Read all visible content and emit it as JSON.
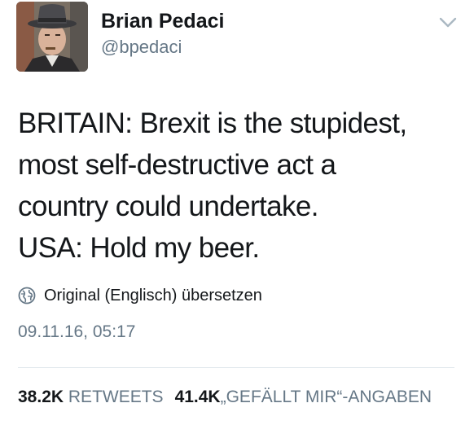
{
  "author": {
    "name": "Brian Pedaci",
    "handle": "@bpedaci"
  },
  "tweet": {
    "lines": [
      "BRITAIN:  Brexit is the stupidest,",
      "most self-destructive act a",
      "country could undertake.",
      "USA:  Hold my beer."
    ]
  },
  "translate": {
    "icon": "globe-icon",
    "label": "Original (Englisch) übersetzen"
  },
  "timestamp": "09.11.16, 05:17",
  "stats": {
    "retweets_count": "38.2K",
    "retweets_label": "RETWEETS",
    "likes_count": "41.4K",
    "likes_label": "„GEFÄLLT MIR“-ANGABEN"
  },
  "colors": {
    "text": "#14171a",
    "secondary": "#657786",
    "divider": "#e1e8ed"
  }
}
